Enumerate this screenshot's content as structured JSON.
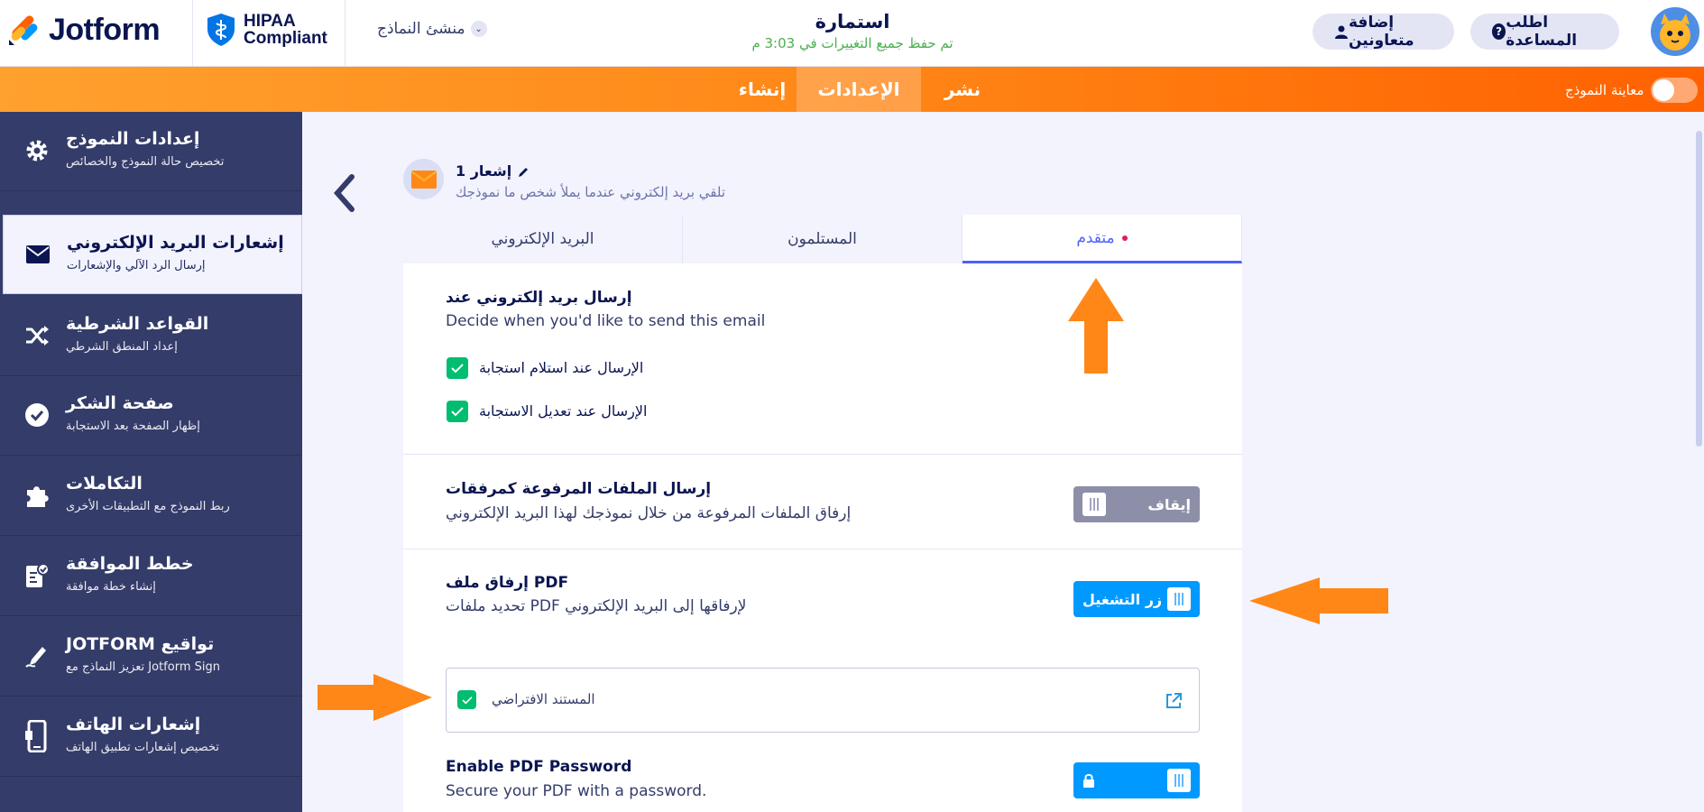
{
  "brand": {
    "name": "Jotform",
    "compliance_line1": "HIPAA",
    "compliance_line2": "Compliant"
  },
  "header": {
    "form_builder": "منشئ النماذج",
    "title": "استمارة",
    "save_status": "تم حفظ جميع التغييرات في 3:03 م",
    "add_collaborators": "إضافة متعاونين",
    "get_help": "اطلب المساعدة"
  },
  "nav": {
    "tabs": [
      "إنشاء",
      "الإعدادات",
      "نشر"
    ],
    "active_tab": "الإعدادات",
    "preview_label": "معاينة النموذج"
  },
  "sidebar": {
    "items": [
      {
        "title": "إعدادات النموذج",
        "sub": "تخصيص حالة النموذج والخصائص",
        "icon": "gear-icon"
      },
      {
        "title": "إشعارات البريد الإلكتروني",
        "sub": "إرسال الرد الآلي والإشعارات",
        "icon": "envelope-icon"
      },
      {
        "title": "القواعد الشرطية",
        "sub": "إعداد المنطق الشرطي",
        "icon": "shuffle-icon"
      },
      {
        "title": "صفحة الشكر",
        "sub": "إظهار الصفحة بعد الاستجابة",
        "icon": "check-circle-icon"
      },
      {
        "title": "التكاملات",
        "sub": "ربط النموذج مع التطبيقات الأخرى",
        "icon": "puzzle-icon"
      },
      {
        "title": "خطط الموافقة",
        "sub": "إنشاء خطة موافقة",
        "icon": "approval-icon"
      },
      {
        "title": "تواقيع JOTFORM",
        "sub": "تعزيز النماذج مع Jotform Sign",
        "icon": "signature-pen-icon"
      },
      {
        "title": "إشعارات الهاتف",
        "sub": "تخصيص إشعارات تطبيق الهاتف",
        "icon": "mobile-icon"
      }
    ]
  },
  "notification": {
    "title": "إشعار 1",
    "subtitle": "تلقي بريد إلكتروني عندما يملأ شخص ما نموذجك"
  },
  "tabs": [
    "البريد الإلكتروني",
    "المستلمون",
    "متقدم"
  ],
  "advanced": {
    "send_when_title": "إرسال بريد إلكتروني عند",
    "send_when_sub": "Decide when you'd like to send this email",
    "opt_on_submit": "الإرسال عند استلام استجابة",
    "opt_on_edit": "الإرسال عند تعديل الاستجابة",
    "attach_uploads_title": "إرسال الملفات المرفوعة كمرفقات",
    "attach_uploads_sub": "إرفاق الملفات المرفوعة من خلال نموذجك لهذا البريد الإلكتروني",
    "attach_uploads_state": "إيقاف",
    "attach_pdf_title": "إرفاق ملف PDF",
    "attach_pdf_sub": "تحديد ملفات PDF لإرفاقها إلى البريد الإلكتروني",
    "attach_pdf_state": "زر التشغيل",
    "default_document": "المستند الافتراضي",
    "pdf_password_title": "Enable PDF Password",
    "pdf_password_sub": "Secure your PDF with a password."
  },
  "colors": {
    "orange": "#ff7b1c",
    "accent_blue": "#4d61fc",
    "switch_on": "#0099ff",
    "check_green": "#01bd6f",
    "sidebar": "#343c6a"
  }
}
